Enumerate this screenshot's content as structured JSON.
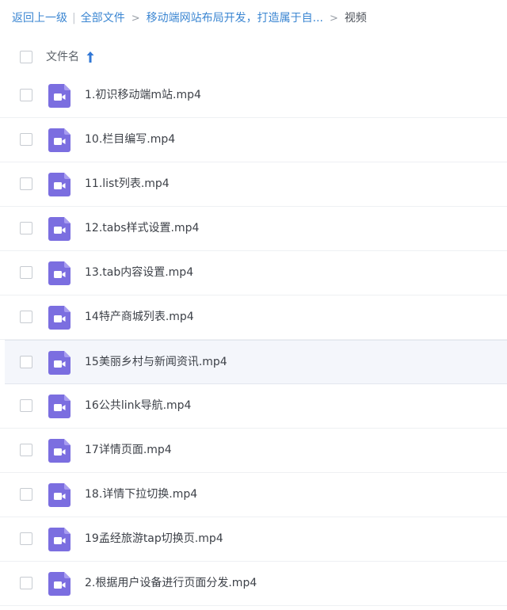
{
  "breadcrumb": {
    "back_label": "返回上一级",
    "separator": "|",
    "all_files_label": "全部文件",
    "arrow": ">",
    "folder_label": "移动端网站布局开发，打造属于自...",
    "current_label": "视频"
  },
  "header": {
    "column_title": "文件名",
    "sort_icon": "arrow-up-icon"
  },
  "colors": {
    "link": "#3b86d2",
    "icon_purple": "#7b6ee0",
    "row_highlight": "#f4f6fb"
  },
  "files": [
    {
      "name": "1.初识移动端m站.mp4",
      "icon": "video-file-icon"
    },
    {
      "name": "10.栏目编写.mp4",
      "icon": "video-file-icon"
    },
    {
      "name": "11.list列表.mp4",
      "icon": "video-file-icon"
    },
    {
      "name": "12.tabs样式设置.mp4",
      "icon": "video-file-icon"
    },
    {
      "name": "13.tab内容设置.mp4",
      "icon": "video-file-icon"
    },
    {
      "name": "14特产商城列表.mp4",
      "icon": "video-file-icon"
    },
    {
      "name": "15美丽乡村与新闻资讯.mp4",
      "icon": "video-file-icon",
      "highlighted": true
    },
    {
      "name": "16公共link导航.mp4",
      "icon": "video-file-icon"
    },
    {
      "name": "17详情页面.mp4",
      "icon": "video-file-icon"
    },
    {
      "name": "18.详情下拉切换.mp4",
      "icon": "video-file-icon"
    },
    {
      "name": "19孟经旅游tap切换页.mp4",
      "icon": "video-file-icon"
    },
    {
      "name": "2.根据用户设备进行页面分发.mp4",
      "icon": "video-file-icon"
    }
  ]
}
